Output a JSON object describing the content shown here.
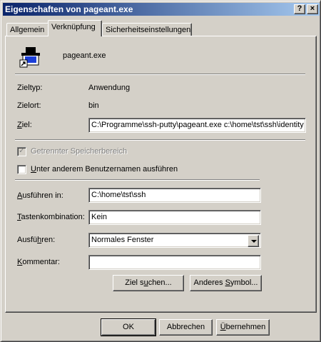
{
  "window": {
    "title": "Eigenschaften von pageant.exe",
    "help_btn": "?",
    "close_btn": "×"
  },
  "tabs": [
    {
      "label": "Allgemein"
    },
    {
      "label": "Verknüpfung"
    },
    {
      "label": "Sicherheitseinstellungen"
    }
  ],
  "file": {
    "name": "pageant.exe"
  },
  "info": {
    "type_label": "Zieltyp:",
    "type_value": "Anwendung",
    "location_label": "Zielort:",
    "location_value": "bin",
    "target_label_u": "Z",
    "target_label_rest": "iel:",
    "target_value": "C:\\Programme\\ssh-putty\\pageant.exe c:\\home\\tst\\ssh\\identity"
  },
  "options": {
    "separate_memory": "Getrennter Speicherbereich",
    "other_user_u": "U",
    "other_user_rest": "nter anderem Benutzernamen ausführen"
  },
  "fields": {
    "start_in_label_u": "A",
    "start_in_label_rest": "usführen in:",
    "start_in_value": "C:\\home\\tst\\ssh",
    "hotkey_label_u": "T",
    "hotkey_label_rest": "astenkombination:",
    "hotkey_value": "Kein",
    "run_label_pre": "Ausfü",
    "run_label_u": "h",
    "run_label_rest": "ren:",
    "run_value": "Normales Fenster",
    "comment_label_u": "K",
    "comment_label_rest": "ommentar:",
    "comment_value": ""
  },
  "buttons": {
    "find_target_pre": "Ziel s",
    "find_target_u": "u",
    "find_target_rest": "chen...",
    "change_icon_pre": "Anderes ",
    "change_icon_u": "S",
    "change_icon_rest": "ymbol...",
    "ok": "OK",
    "cancel": "Abbrechen",
    "apply_u": "Ü",
    "apply_rest": "bernehmen"
  }
}
